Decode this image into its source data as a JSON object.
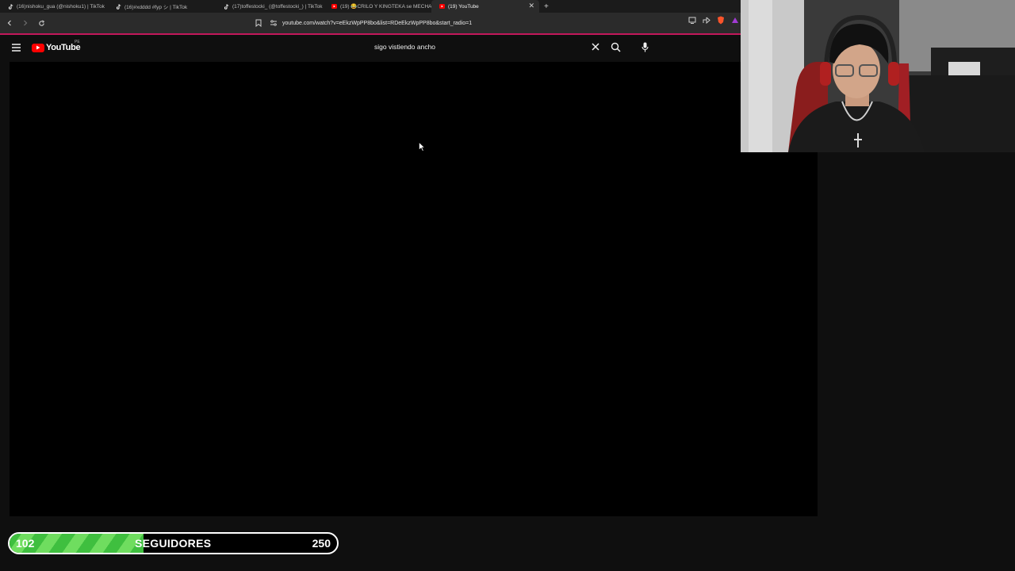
{
  "browser": {
    "tabs": [
      {
        "title": "(16)nishoku_gua (@nishoku1) | TikTok",
        "icon": "tiktok-icon",
        "active": false
      },
      {
        "title": "(16)#xdddd #fyp シ | TikTok",
        "icon": "tiktok-icon",
        "active": false
      },
      {
        "title": "(17)toffestocki_ (@toffestocki_) | TikTok",
        "icon": "tiktok-icon",
        "active": false
      },
      {
        "title": "(19) 😂CRILO Y KINGTEKA se MECHAN",
        "icon": "youtube-icon",
        "active": false
      },
      {
        "title": "(19) YouTube",
        "icon": "youtube-icon",
        "active": true
      }
    ],
    "url": "youtube.com/watch?v=eEkzWpPP8bo&list=RDeEkzWpPP8bo&start_radio=1"
  },
  "youtube": {
    "logo_text": "YouTube",
    "region": "PE",
    "search_value": "sigo vistiendo ancho"
  },
  "goal": {
    "current": "102",
    "label": "SEGUIDORES",
    "target": "250",
    "progress": 0.408
  },
  "colors": {
    "accent_red": "#ff0000",
    "tab_line": "#c2185b",
    "goal_green": "#3fbf3f"
  }
}
